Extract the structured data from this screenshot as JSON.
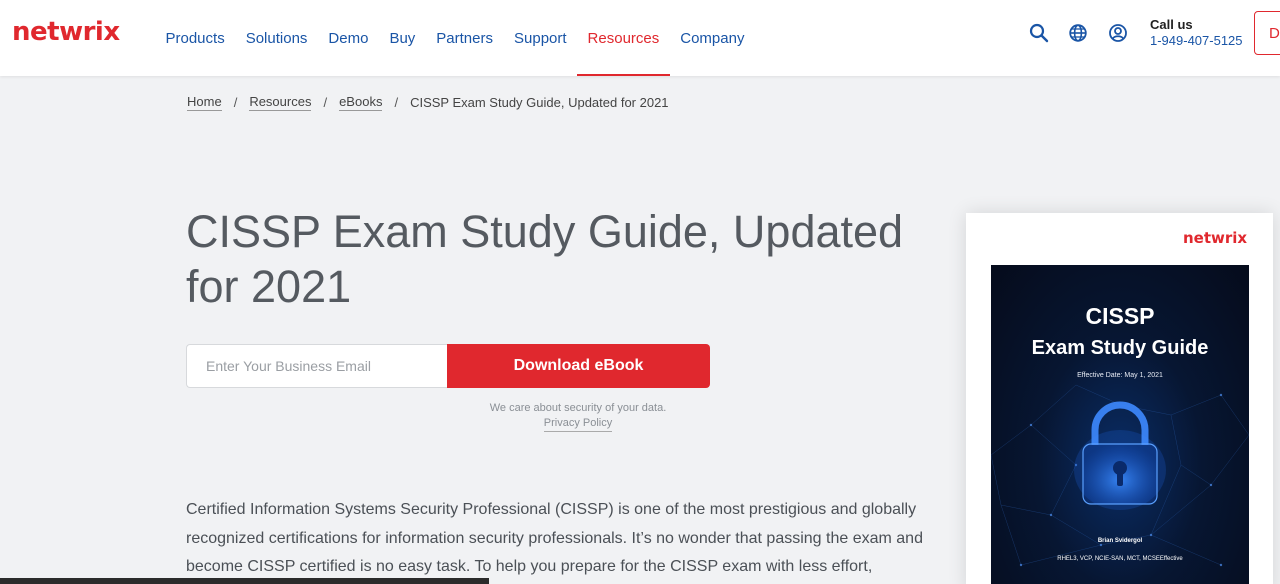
{
  "brand": {
    "logo_text": "netwrix",
    "accent": "#e0282e",
    "link_color": "#1a55a6"
  },
  "nav": {
    "items": [
      {
        "label": "Products"
      },
      {
        "label": "Solutions"
      },
      {
        "label": "Demo"
      },
      {
        "label": "Buy"
      },
      {
        "label": "Partners"
      },
      {
        "label": "Support"
      },
      {
        "label": "Resources",
        "active": true
      },
      {
        "label": "Company"
      }
    ]
  },
  "header": {
    "icons": [
      "search-icon",
      "globe-icon",
      "user-icon"
    ],
    "call_title": "Call us",
    "call_phone": "1-949-407-5125",
    "demo_button": "D"
  },
  "breadcrumb": {
    "items": [
      "Home",
      "Resources",
      "eBooks"
    ],
    "separator": "/",
    "current": "CISSP Exam Study Guide, Updated for 2021"
  },
  "main": {
    "title": "CISSP Exam Study Guide, Updated for 2021",
    "email_placeholder": "Enter Your Business Email",
    "download_label": "Download eBook",
    "privacy_note": "We care about security of your data.",
    "privacy_link": "Privacy Policy",
    "intro": "Certified Information Systems Security Professional (CISSP) is one of the most prestigious and globally recognized certifications for information security professionals. It’s no wonder that passing the exam and become CISSP certified is no easy task. To help you prepare for the CISSP exam with less effort,"
  },
  "book": {
    "logo_text": "netwrix",
    "title": "CISSP",
    "subtitle": "Exam Study Guide",
    "date": "Effective Date: May 1, 2021",
    "author": "Brian Svidergol",
    "credentials": "RHEL3, VCP, NCIE-SAN, MCT, MCSEEffective"
  }
}
